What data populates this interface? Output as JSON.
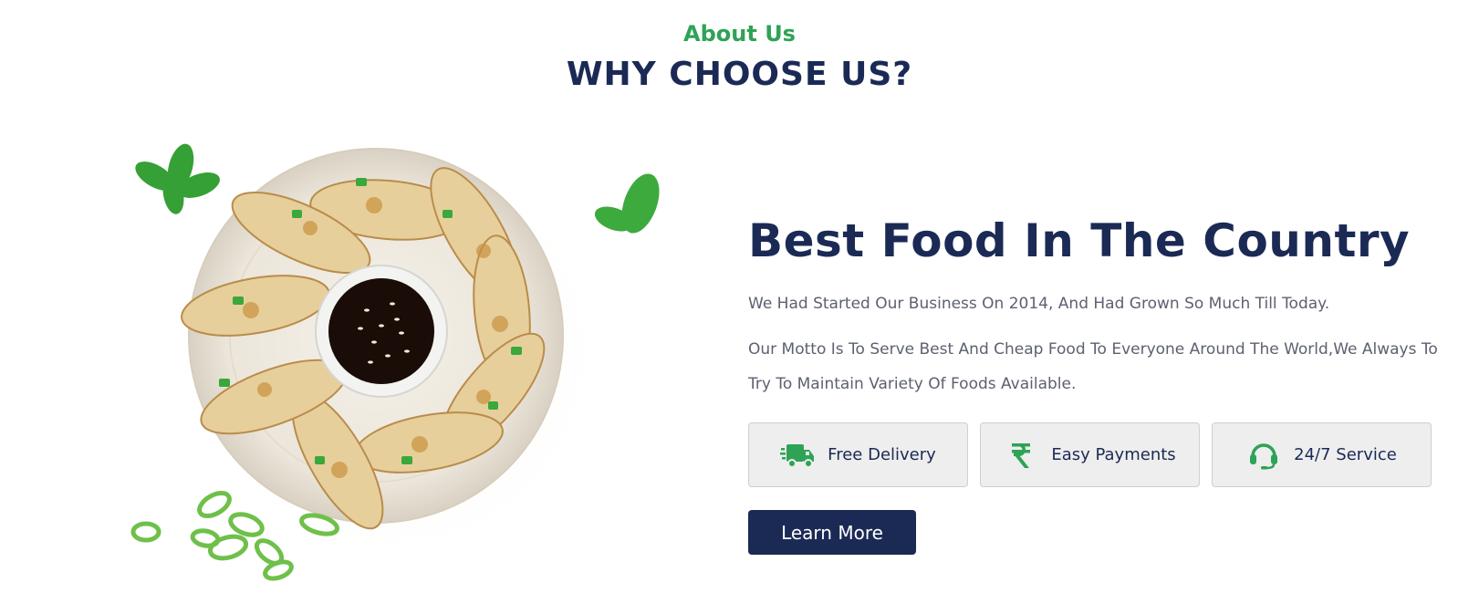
{
  "section": {
    "eyebrow": "About Us",
    "title": "WHY CHOOSE US?"
  },
  "content": {
    "headline": "Best Food In The Country",
    "paragraph_1": "We Had Started Our Business On 2014, And Had Grown So Much Till Today.",
    "paragraph_2": "Our Motto Is To Serve Best And Cheap Food To Everyone Around The World,We Always To Try To Maintain Variety Of Foods Available."
  },
  "features": [
    {
      "label": "Free Delivery",
      "icon": "delivery-truck-icon"
    },
    {
      "label": "Easy Payments",
      "icon": "rupee-icon"
    },
    {
      "label": "24/7 Service",
      "icon": "headset-icon"
    }
  ],
  "cta": {
    "label": "Learn More"
  },
  "image": {
    "subject": "food-plate-image"
  },
  "colors": {
    "accent_green": "#2ea356",
    "navy": "#1b2a55",
    "body_text": "#5c6170",
    "feature_bg": "#eeeeee"
  }
}
